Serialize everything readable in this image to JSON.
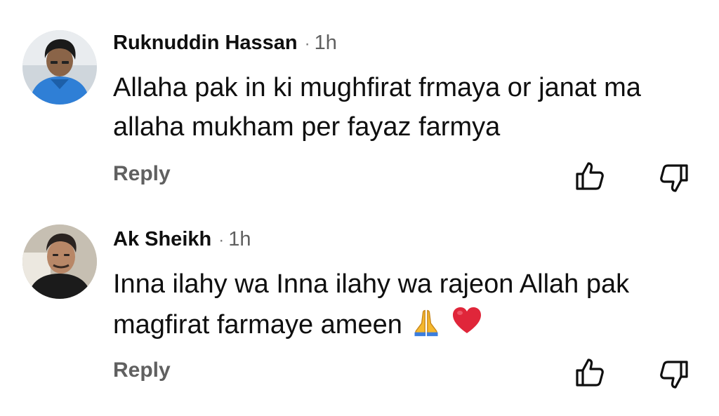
{
  "comments": [
    {
      "author": "Ruknuddin Hassan",
      "separator": "·",
      "time": "1h",
      "text": "Allaha pak in ki mughfirat frmaya or janat ma allaha mukham per fayaz farmya",
      "reply_label": "Reply",
      "avatar": "profile-photo-man-blue-shirt"
    },
    {
      "author": "Ak Sheikh",
      "separator": "·",
      "time": "1h",
      "text": "Inna ilahy wa Inna ilahy wa rajeon Allah pak magfirat farmaye ameen",
      "emojis": [
        "folded-hands-emoji",
        "red-heart-emoji"
      ],
      "reply_label": "Reply",
      "avatar": "profile-photo-man-black-shirt"
    }
  ],
  "icons": {
    "like": "thumbs-up-icon",
    "dislike": "thumbs-down-icon"
  },
  "colors": {
    "text_primary": "#0f0f0f",
    "text_secondary": "#606060",
    "background": "#ffffff",
    "heart": "#e0263a",
    "hands": "#f5b82e"
  }
}
